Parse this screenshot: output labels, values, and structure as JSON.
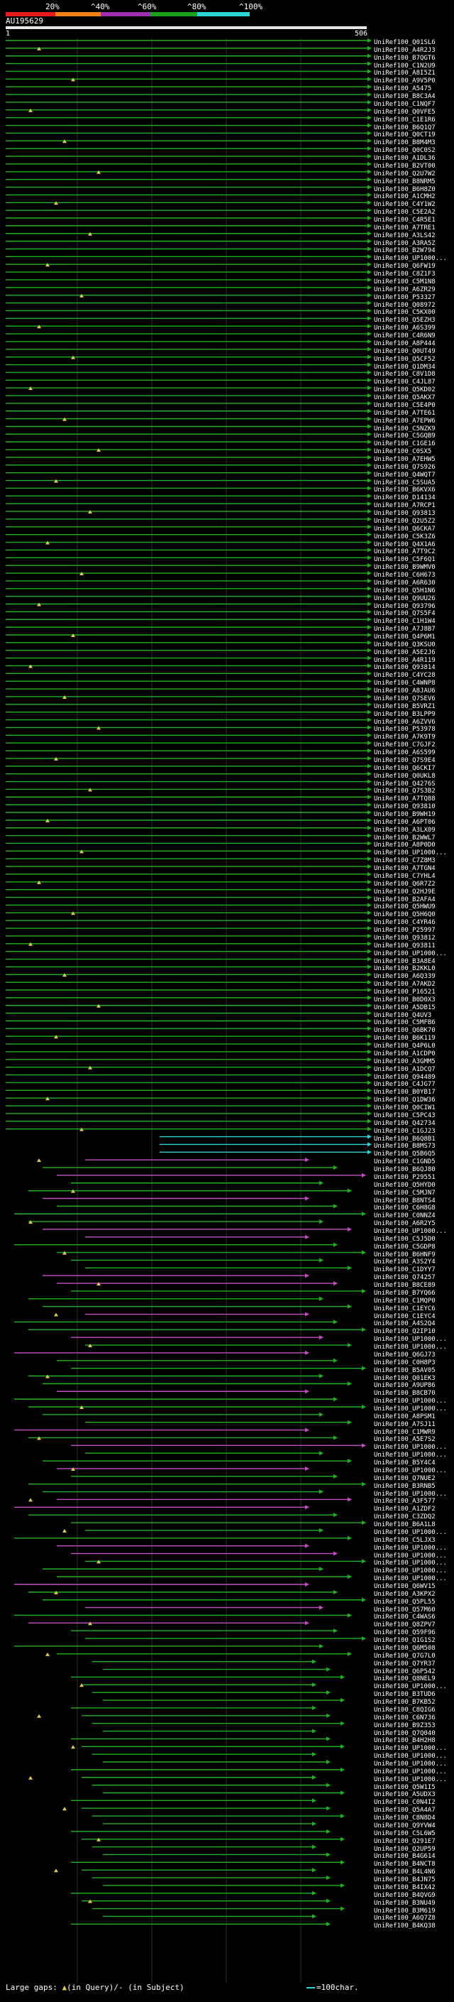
{
  "scale": {
    "labels": [
      "20%",
      "^40%",
      "^60%",
      "^80%",
      "^100%"
    ],
    "colors": [
      "#e41a1c",
      "#f07f14",
      "#9b2fae",
      "#1aa01a",
      "#2bd6d6"
    ]
  },
  "query": {
    "title": "AU195629",
    "start": "1",
    "end": "506"
  },
  "hits_visible_in_order": [
    "UniRef100_Q01SL6",
    "UniRef100_A4R2J3",
    "UniRef100_B7QGT6",
    "UniRef100_C1N2U9",
    "UniRef100_A8I5Z1",
    "UniRef100_A9V5P0",
    "UniRef100_A5475",
    "UniRef100_B8C3A4",
    "UniRef100_C1NQF7",
    "UniRef100_Q0VFE5",
    "UniRef100_C1E1R6",
    "UniRef100_B6Q1Q7",
    "UniRef100_Q0CT19",
    "UniRef100_B8M4M3",
    "UniRef100_Q0C0S2",
    "UniRef100_A1DL36",
    "UniRef100_B2VT00",
    "UniRef100_Q2U7W2",
    "UniRef100_B8NRM5",
    "UniRef100_B6H8Z0",
    "UniRef100_A1CMH2",
    "UniRef100_C4Y1W2",
    "UniRef100_C5E2A2",
    "UniRef100_C4R5E1",
    "UniRef100_A7TRE1",
    "UniRef100_A3LS42",
    "UniRef100_A3RA5Z",
    "UniRef100_B2W794",
    "UniRef100_UP1000...",
    "UniRef100_Q6FW19",
    "UniRef100_C8Z1F3",
    "UniRef100_C5M1N8",
    "UniRef100_A6ZR29",
    "UniRef100_P53327",
    "UniRef100_Q08972",
    "UniRef100_C5KX00",
    "UniRef100_Q5EZH3",
    "UniRef100_A6S399",
    "UniRef100_C4R6N9",
    "UniRef100_A8P444",
    "UniRef100_Q0UT49",
    "UniRef100_Q5CF52",
    "UniRef100_Q1DM34",
    "UniRef100_C8V1D8",
    "UniRef100_C4JL87",
    "UniRef100_Q5KD02",
    "UniRef100_Q5AKX7",
    "UniRef100_C5E4P0",
    "UniRef100_A7TE61",
    "UniRef100_A7EPW6",
    "UniRef100_C5NZK9",
    "UniRef100_C5GQB9",
    "UniRef100_C1GE16",
    "UniRef100_C0SX5",
    "UniRef100_A7EHW5",
    "UniRef100_Q7S926",
    "UniRef100_Q4WQT7",
    "UniRef100_C5SUA5",
    "UniRef100_B6KVX6",
    "UniRef100_D14134",
    "UniRef100_A7RCP1",
    "UniRef100_Q93813",
    "UniRef100_Q2U5Z2",
    "UniRef100_Q6CKA7",
    "UniRef100_C5K3Z6",
    "UniRef100_Q4X1A6",
    "UniRef100_A7T9C2",
    "UniRef100_C5F6Q1",
    "UniRef100_B9WMV0",
    "UniRef100_C6H673",
    "UniRef100_A6R630",
    "UniRef100_Q5H1N6",
    "UniRef100_Q9UU26",
    "UniRef100_Q93796",
    "UniRef100_Q7S5F4",
    "UniRef100_C1H1W4",
    "UniRef100_A7J8B7",
    "UniRef100_Q4P6M1",
    "UniRef100_Q3KSU0",
    "UniRef100_A5E2J6",
    "UniRef100_A4R119",
    "UniRef100_Q93814",
    "UniRef100_C4YC28",
    "UniRef100_C4WNP8",
    "UniRef100_A8JAU6",
    "UniRef100_Q7SEV6",
    "UniRef100_B5VRZ1",
    "UniRef100_B3LPP9",
    "UniRef100_A6ZVV6",
    "UniRef100_P53978",
    "UniRef100_A7K9T9",
    "UniRef100_C7GJF2",
    "UniRef100_A6S599",
    "UniRef100_Q7S9E4",
    "UniRef100_Q6CKI7",
    "UniRef100_Q0UKL8",
    "UniRef100_Q4276S",
    "UniRef100_Q7S3B2",
    "UniRef100_A7TQ88",
    "UniRef100_Q93810",
    "UniRef100_B9WH19",
    "UniRef100_A6PT06",
    "UniRef100_A3LX09",
    "UniRef100_B2WWL7",
    "UniRef100_A8P0D0",
    "UniRef100_UP1000...",
    "UniRef100_C7Z8M3",
    "UniRef100_A7TGN4",
    "UniRef100_C7YHL4",
    "UniRef100_Q6R7Z2",
    "UniRef100_Q2HJ9E",
    "UniRef100_B2AFA4",
    "UniRef100_Q5HWU9",
    "UniRef100_Q5H6Q0",
    "UniRef100_C4YR46",
    "UniRef100_P25997",
    "UniRef100_Q93812",
    "UniRef100_Q93811",
    "UniRef100_UP1000...",
    "UniRef100_B3A8E4",
    "UniRef100_B2KKL0",
    "UniRef100_A6Q339",
    "UniRef100_A7AKD2",
    "UniRef100_P16521",
    "UniRef100_B0D0X3",
    "UniRef100_A5DB15",
    "UniRef100_Q4UV3",
    "UniRef100_C5MFB6",
    "UniRef100_Q6BK70",
    "UniRef100_B6K119",
    "UniRef100_Q4P6L0",
    "UniRef100_A1CDP0",
    "UniRef100_A3GMM5",
    "UniRef100_A1DCQ7",
    "UniRef100_Q94489",
    "UniRef100_C4JG77",
    "UniRef100_B0YB17",
    "UniRef100_Q1DW36",
    "UniRef100_Q0CIW1",
    "UniRef100_C5PC43",
    "UniRef100_Q42734",
    "UniRef100_C1GJ23",
    "UniRef100_B6Q8B1",
    "UniRef100_B8MS73",
    "UniRef100_Q5B6Q5",
    "UniRef100_C1GND5",
    "UniRef100_B6QJ80",
    "UniRef100_P29551",
    "UniRef100_Q5HYD0",
    "UniRef100_C5MJN7",
    "UniRef100_B8NTS4",
    "UniRef100_C6H8G8",
    "UniRef100_C0NNZ4",
    "UniRef100_A6R2Y5",
    "UniRef100_UP1000...",
    "UniRef100_C5J5D0",
    "UniRef100_C5GDP8",
    "UniRef100_B6HNF9",
    "UniRef100_A3S2Y4",
    "UniRef100_C1DYY7",
    "UniRef100_Q74257",
    "UniRef100_B8CE89",
    "UniRef100_B7YQ66",
    "UniRef100_C1MQP0",
    "UniRef100_C1EYC6",
    "UniRef100_C1EYC4",
    "UniRef100_A4S2Q4",
    "UniRef100_Q2IP10",
    "UniRef100_UP1000...",
    "UniRef100_UP1000...",
    "UniRef100_Q6GJ73",
    "UniRef100_C0H8P3",
    "UniRef100_B5AV05",
    "UniRef100_Q01EK3",
    "UniRef100_A9UP86",
    "UniRef100_B8CB70",
    "UniRef100_UP1000...",
    "UniRef100_UP1000...",
    "UniRef100_A8PSM1",
    "UniRef100_A7SJ11",
    "UniRef100_C1MWR9",
    "UniRef100_A5E7S2",
    "UniRef100_UP1000...",
    "UniRef100_UP1000...",
    "UniRef100_B5Y4C4",
    "UniRef100_UP1000...",
    "UniRef100_Q7NUE2",
    "UniRef100_B3RNB5",
    "UniRef100_UP1000...",
    "UniRef100_A3F577",
    "UniRef100_A1ZDF2",
    "UniRef100_C3ZDQ2",
    "UniRef100_B6A1L8",
    "UniRef100_UP1000...",
    "UniRef100_C5LJX3",
    "UniRef100_UP1000...",
    "UniRef100_UP1000...",
    "UniRef100_UP1000...",
    "UniRef100_UP1000...",
    "UniRef100_UP1000...",
    "UniRef100_Q6WV15",
    "UniRef100_A3KPX2",
    "UniRef100_Q5PL55",
    "UniRef100_Q57M60",
    "UniRef100_C4WAS6",
    "UniRef100_Q8ZPV7",
    "UniRef100_Q59F96",
    "UniRef100_Q1G1S2",
    "UniRef100_Q6M508",
    "UniRef100_Q7G7L0",
    "UniRef100_Q7YR37",
    "UniRef100_Q6P542",
    "UniRef100_Q8NEL9",
    "UniRef100_UP1000...",
    "UniRef100_B3TUD6",
    "UniRef100_B7KB52",
    "UniRef100_C8QIG6",
    "UniRef100_C6N736",
    "UniRef100_B9Z353",
    "UniRef100_Q7Q040",
    "UniRef100_B4H2H8",
    "UniRef100_UP1000...",
    "UniRef100_UP1000...",
    "UniRef100_UP1000...",
    "UniRef100_UP1000...",
    "UniRef100_UP1000...",
    "UniRef100_Q5W1I5",
    "UniRef100_A5UDX3",
    "UniRef100_C0N4I2",
    "UniRef100_Q5A4A7",
    "UniRef100_C8N8D4",
    "UniRef100_Q9YVW4",
    "UniRef100_C5L6W5",
    "UniRef100_Q291E7",
    "UniRef100_Q2UP59",
    "UniRef100_B4G614",
    "UniRef100_B4NCT8",
    "UniRef100_B4L4N6",
    "UniRef100_B4JN75",
    "UniRef100_B4IX42",
    "UniRef100_B4QVG9",
    "UniRef100_B3NU49",
    "UniRef100_B3M619",
    "UniRef100_A6Q7Z8",
    "UniRef100_B4KQ38"
  ],
  "footer": {
    "large_gaps": "Large gaps: ",
    "in_query": "(in Query)/",
    "dash_label": "(in Subject)",
    "scale_text": "=100char."
  }
}
